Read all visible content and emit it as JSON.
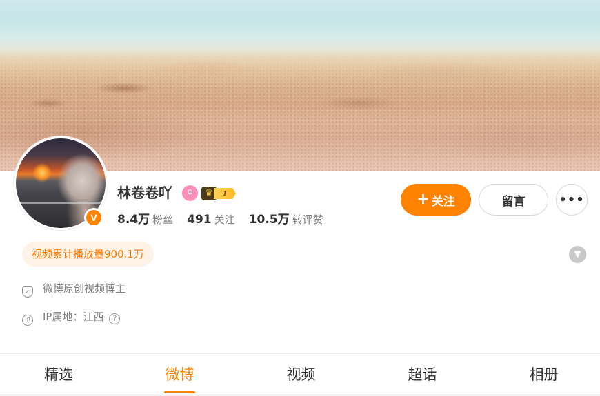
{
  "profile": {
    "name": "林卷卷吖",
    "verified_badge": "V",
    "vip_icon": "vip-lens-icon",
    "level": "1"
  },
  "stats": [
    {
      "value": "8.4万",
      "label": "粉丝"
    },
    {
      "value": "491",
      "label": "关注"
    },
    {
      "value": "10.5万",
      "label": "转评赞"
    }
  ],
  "actions": {
    "follow_label": "关注",
    "message_label": "留言",
    "more_label": "•••"
  },
  "play_count": "视频累计播放量900.1万",
  "info": {
    "creator_tag": "微博原创视频博主",
    "ip_location": "IP属地：江西"
  },
  "tabs": [
    {
      "label": "精选",
      "active": false
    },
    {
      "label": "微博",
      "active": true
    },
    {
      "label": "视频",
      "active": false
    },
    {
      "label": "超话",
      "active": false
    },
    {
      "label": "相册",
      "active": false
    }
  ],
  "colors": {
    "accent": "#ff8200",
    "badge_bg": "#fff3e8"
  }
}
